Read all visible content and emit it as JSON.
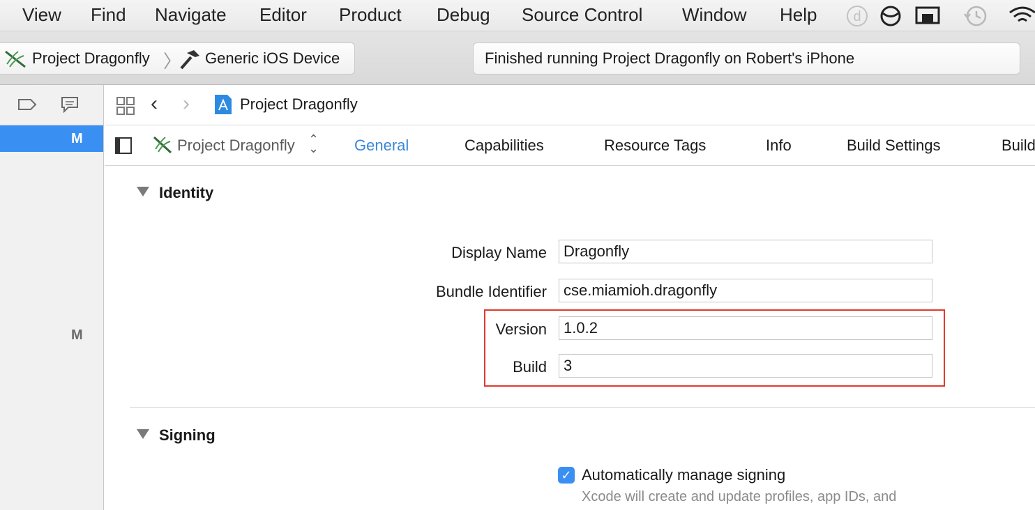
{
  "menubar": {
    "items": [
      "View",
      "Find",
      "Navigate",
      "Editor",
      "Product",
      "Debug",
      "Source Control",
      "Window",
      "Help"
    ]
  },
  "toolbar": {
    "scheme": "Project Dragonfly",
    "destination": "Generic iOS Device",
    "activity_status": "Finished running Project Dragonfly on Robert's iPhone"
  },
  "navigator": {
    "badge_selected": "M",
    "badge_other": "M"
  },
  "jumpbar": {
    "title": "Project Dragonfly"
  },
  "tabs": {
    "target_name": "Project Dragonfly",
    "items": [
      "General",
      "Capabilities",
      "Resource Tags",
      "Info",
      "Build Settings",
      "Build"
    ],
    "active": "General"
  },
  "identity": {
    "title": "Identity",
    "display_name_label": "Display Name",
    "display_name": "Dragonfly",
    "bundle_id_label": "Bundle Identifier",
    "bundle_id": "cse.miamioh.dragonfly",
    "version_label": "Version",
    "version": "1.0.2",
    "build_label": "Build",
    "build": "3"
  },
  "signing": {
    "title": "Signing",
    "auto_label": "Automatically manage signing",
    "auto_checked": true,
    "note": "Xcode will create and update profiles, app IDs, and"
  },
  "colors": {
    "accent": "#3a8ff2",
    "active_tab": "#3a86d6",
    "highlight": "#e03a2f"
  }
}
